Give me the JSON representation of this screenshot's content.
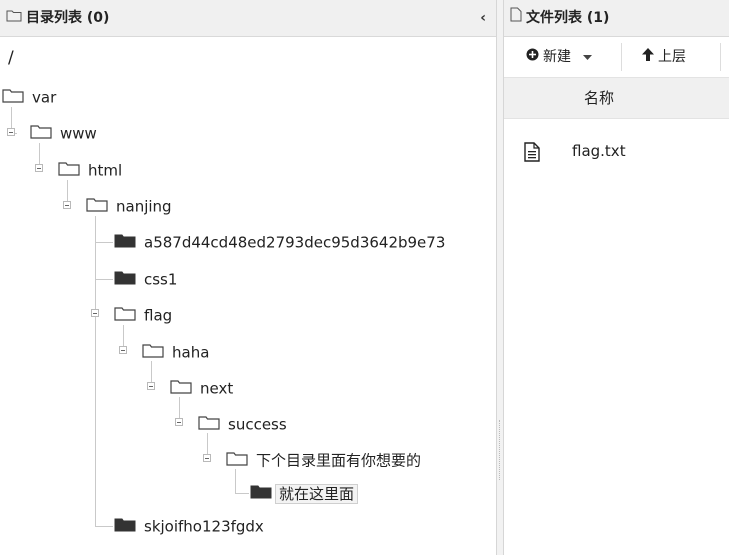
{
  "dir_panel": {
    "title": "目录列表 (0)",
    "collapse_icon": "‹",
    "root": "/",
    "tree": [
      {
        "label": "var"
      },
      {
        "label": "www"
      },
      {
        "label": "html"
      },
      {
        "label": "nanjing"
      },
      {
        "label": "a587d44cd48ed2793dec95d3642b9e73"
      },
      {
        "label": "css1"
      },
      {
        "label": "flag"
      },
      {
        "label": "haha"
      },
      {
        "label": "next"
      },
      {
        "label": "success"
      },
      {
        "label": "下个目录里面有你想要的"
      },
      {
        "label": "就在这里面",
        "selected": true
      },
      {
        "label": "skjoifho123fgdx"
      }
    ]
  },
  "file_panel": {
    "title": "文件列表 (1)",
    "toolbar": {
      "new_label": "新建",
      "new_icon": "plus-circle-icon",
      "up_label": "上层",
      "up_icon": "arrow-up-icon"
    },
    "column_name": "名称",
    "files": [
      {
        "name": "flag.txt",
        "icon": "text-file-icon"
      }
    ]
  }
}
